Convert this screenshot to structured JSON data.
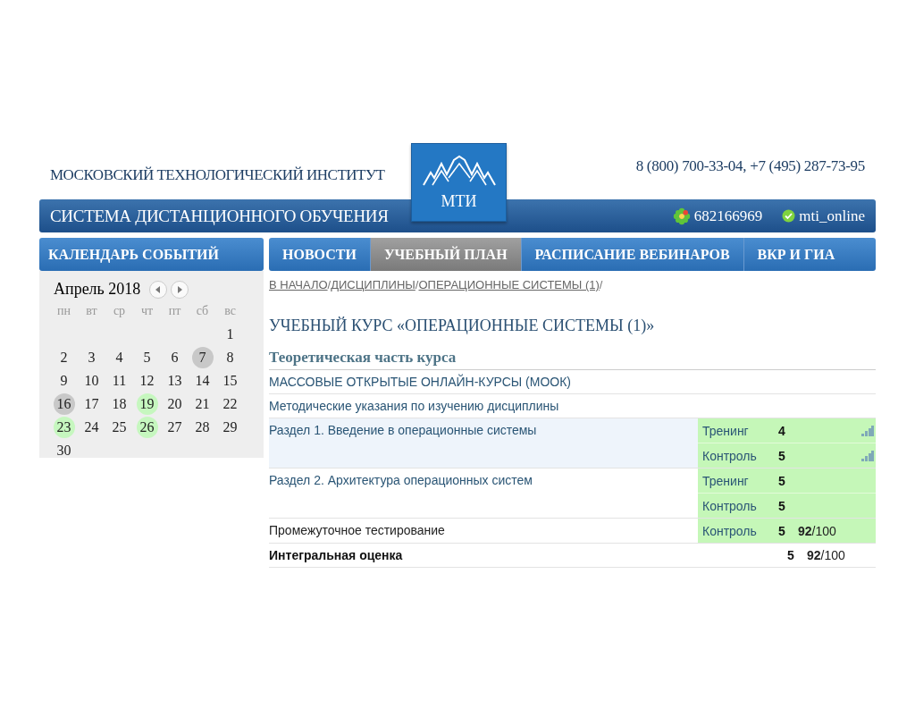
{
  "header": {
    "institute": "МОСКОВСКИЙ ТЕХНОЛОГИЧЕСКИЙ ИНСТИТУТ",
    "logo_text": "МТИ",
    "phones": "8 (800) 700-33-04, +7 (495) 287-73-95",
    "system": "СИСТЕМА ДИСТАНЦИОННОГО ОБУЧЕНИЯ",
    "icq": "682166969",
    "skype": "mti_online"
  },
  "sidebar": {
    "title": "КАЛЕНДАРЬ СОБЫТИЙ",
    "month": "Апрель 2018",
    "weekdays": [
      "пн",
      "вт",
      "ср",
      "чт",
      "пт",
      "сб",
      "вс"
    ],
    "weeks": [
      [
        {
          "day": "1"
        }
      ],
      [
        {
          "day": "2"
        },
        {
          "day": "3"
        },
        {
          "day": "4"
        },
        {
          "day": "5"
        },
        {
          "day": "6"
        },
        {
          "day": "7",
          "color": "#c8c8c8"
        },
        {
          "day": "8"
        }
      ],
      [
        {
          "day": "9"
        },
        {
          "day": "10"
        },
        {
          "day": "11"
        },
        {
          "day": "12"
        },
        {
          "day": "13"
        },
        {
          "day": "14"
        },
        {
          "day": "15"
        }
      ],
      [
        {
          "day": "16",
          "color": "#c8c8c8"
        },
        {
          "day": "17"
        },
        {
          "day": "18"
        },
        {
          "day": "19",
          "color": "#c6f7bf"
        },
        {
          "day": "20"
        },
        {
          "day": "21"
        },
        {
          "day": "22"
        }
      ],
      [
        {
          "day": "23",
          "color": "#c6f7bf"
        },
        {
          "day": "24"
        },
        {
          "day": "25"
        },
        {
          "day": "26",
          "color": "#c6f7bf"
        },
        {
          "day": "27"
        },
        {
          "day": "28"
        },
        {
          "day": "29"
        }
      ],
      [
        {
          "day": "30"
        }
      ]
    ]
  },
  "nav": [
    {
      "label": "НОВОСТИ",
      "selected": false
    },
    {
      "label": "УЧЕБНЫЙ ПЛАН",
      "selected": true
    },
    {
      "label": "РАСПИСАНИЕ ВЕБИНАРОВ",
      "selected": false
    },
    {
      "label": "ВКР И ГИА",
      "selected": false
    }
  ],
  "breadcrumbs": [
    {
      "label": "В НАЧАЛО",
      "separator": "/"
    },
    {
      "label": "ДИСЦИПЛИНЫ",
      "separator": "/"
    },
    {
      "label": "ОПЕРАЦИОННЫЕ СИСТЕМЫ (1)",
      "separator": "/"
    }
  ],
  "course_title": "УЧЕБНЫЙ КУРС «ОПЕРАЦИОННЫЕ СИСТЕМЫ (1)»",
  "section_title": "Теоретическая часть курса",
  "rows": [
    {
      "kind": "link",
      "title": "МАССОВЫЕ ОТКРЫТЫЕ ОНЛАЙН-КУРСЫ (МООК)"
    },
    {
      "kind": "link",
      "title": "Методические указания по изучению дисциплины"
    },
    {
      "kind": "section",
      "title": "Раздел 1. Введение в операционные системы",
      "selected": true,
      "activities": [
        {
          "type": "Тренинг",
          "grade": "4",
          "stats": true
        },
        {
          "type": "Контроль",
          "grade": "5",
          "stats": true
        }
      ]
    },
    {
      "kind": "section",
      "title": "Раздел 2. Архитектура операционных систем",
      "selected": false,
      "activities": [
        {
          "type": "Тренинг",
          "grade": "5",
          "stats": false
        },
        {
          "type": "Контроль",
          "grade": "5",
          "stats": false
        }
      ]
    },
    {
      "kind": "test",
      "title": "Промежуточное тестирование",
      "selected": false,
      "activities": [
        {
          "type": "Контроль",
          "grade": "5",
          "score": "**92**/100",
          "stats": false
        }
      ]
    },
    {
      "kind": "total",
      "title": "Интегральная оценка",
      "grade": "5",
      "score": "**92**/100"
    }
  ]
}
